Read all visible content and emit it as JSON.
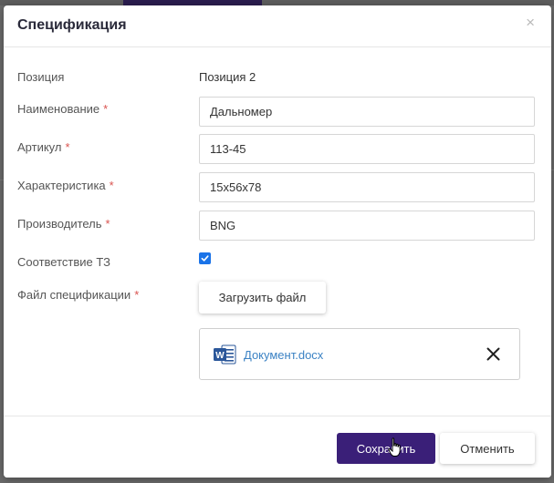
{
  "dialog": {
    "title": "Спецификация",
    "close_glyph": "×"
  },
  "form": {
    "position": {
      "label": "Позиция",
      "value": "Позиция 2"
    },
    "name": {
      "label": "Наименование",
      "required": "*",
      "value": "Дальномер"
    },
    "article": {
      "label": "Артикул",
      "required": "*",
      "value": "113-45"
    },
    "characteristic": {
      "label": "Характеристика",
      "required": "*",
      "value": "15x56x78"
    },
    "manufacturer": {
      "label": "Производитель",
      "required": "*",
      "value": "BNG"
    },
    "compliance": {
      "label": "Соответствие ТЗ",
      "checked": true
    },
    "spec_file": {
      "label": "Файл спецификации",
      "required": "*",
      "upload_label": "Загрузить файл",
      "file_name": "Документ.docx",
      "file_icon": "word-icon",
      "icon_letter": "W"
    }
  },
  "footer": {
    "save_label": "Сохранить",
    "cancel_label": "Отменить"
  },
  "colors": {
    "primary": "#3a1f78",
    "required": "#d9534f",
    "link": "#3b82c4",
    "checkbox": "#1a73e8",
    "word_blue": "#2b579a"
  }
}
